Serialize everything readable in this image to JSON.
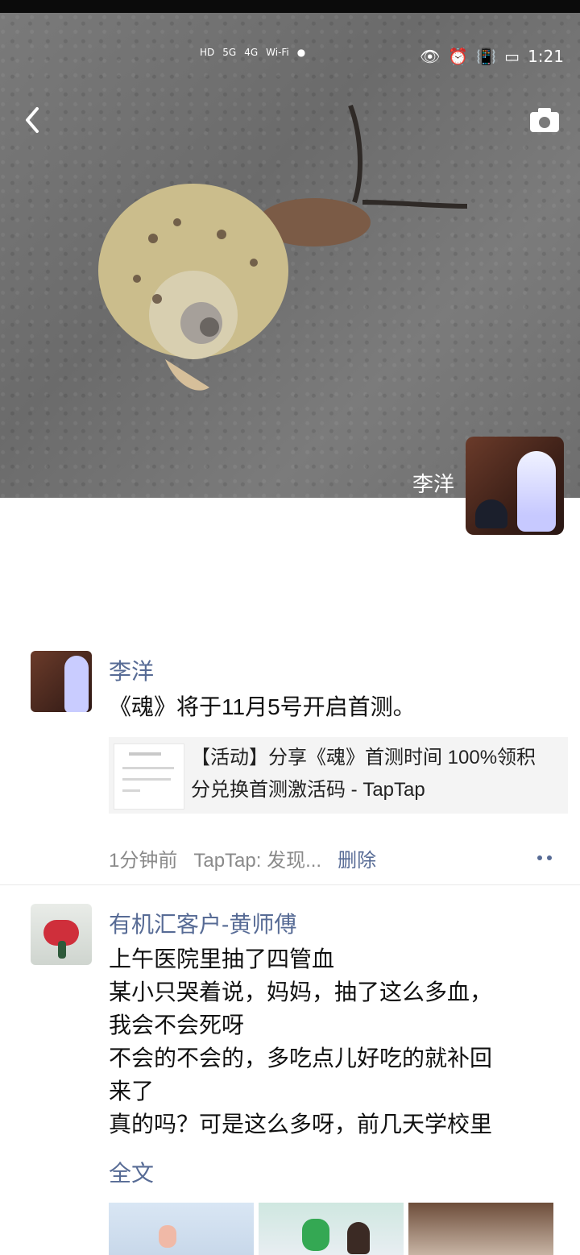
{
  "status_bar": {
    "left": [
      "HD",
      "5G",
      "4G",
      "Wi‑Fi",
      "●"
    ],
    "right_icons": [
      "eye-icon",
      "alarm-icon",
      "vibrate-icon",
      "battery-icon"
    ],
    "time": "1:21"
  },
  "header": {
    "back_icon": "chevron-left-icon",
    "camera_icon": "camera-icon",
    "owner_name": "李洋"
  },
  "posts": [
    {
      "name": "李洋",
      "text": "《魂》将于11月5号开启首测。",
      "share": {
        "title": "【活动】分享《魂》首测时间 100%领积分兑换首测激活码 - TapTap"
      },
      "meta": {
        "time": "1分钟前",
        "source": "TapTap: 发现...",
        "delete": "删除"
      },
      "more_icon": "more-icon"
    },
    {
      "name": "有机汇客户-黄师傅",
      "text": "上午医院里抽了四管血\n某小只哭着说，妈妈，抽了这么多血，\n我会不会死呀\n不会的不会的，多吃点儿好吃的就补回\n来了\n真的吗？可是这么多呀，前几天学校里",
      "full_text_label": "全文"
    }
  ],
  "colors": {
    "link_blue": "#576b95",
    "meta_gray": "#8a8a8a",
    "share_bg": "#f4f4f4"
  }
}
